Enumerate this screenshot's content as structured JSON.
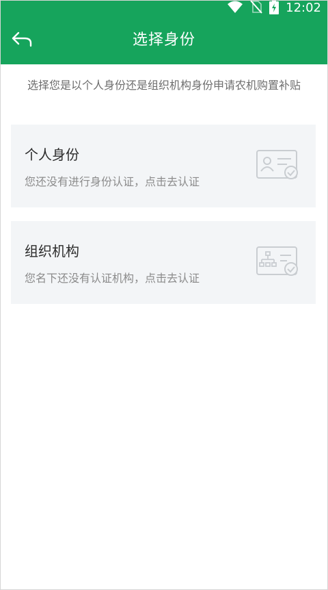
{
  "status_bar": {
    "time": "12:02",
    "icons": [
      "wifi-icon",
      "no-sim-icon",
      "battery-charging-icon"
    ]
  },
  "header": {
    "back_icon": "back-arrow-icon",
    "title": "选择身份",
    "color": "#16a45c"
  },
  "intro": {
    "text": "选择您是以个人身份还是组织机构身份申请农机购置补贴"
  },
  "options": [
    {
      "title": "个人身份",
      "subtitle": "您还没有进行身份认证，点击去认证",
      "icon": "id-card-check-icon"
    },
    {
      "title": "组织机构",
      "subtitle": "您名下还没有认证机构，点击去认证",
      "icon": "org-chart-check-icon"
    }
  ]
}
